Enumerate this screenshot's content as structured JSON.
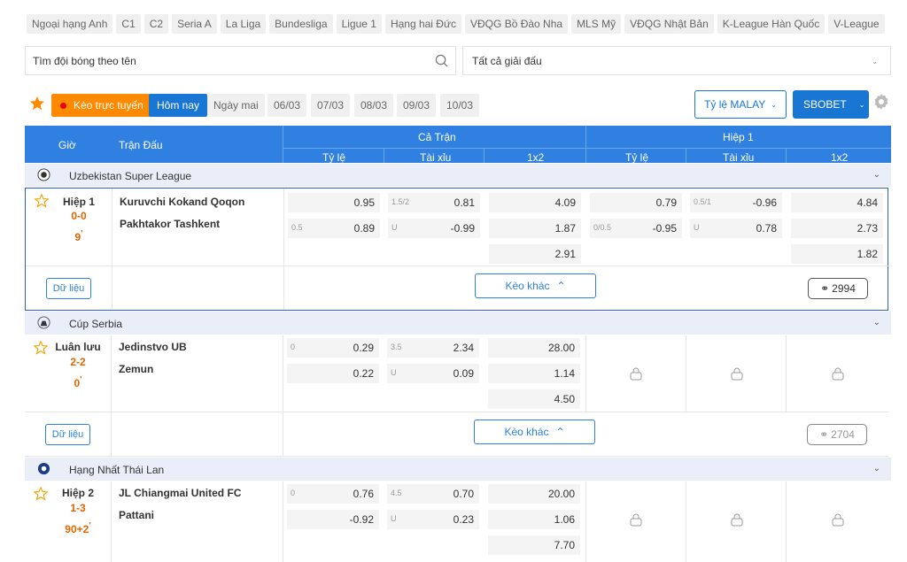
{
  "leagues": [
    "Ngoại hạng Anh",
    "C1",
    "C2",
    "Seria A",
    "La Liga",
    "Bundesliga",
    "Ligue 1",
    "Hạng hai Đức",
    "VĐQG Bồ Đào Nha",
    "MLS Mỹ",
    "VĐQG Nhật Bản",
    "K-League Hàn Quốc",
    "V-League"
  ],
  "search": {
    "placeholder": "Tìm đội bóng theo tên"
  },
  "tournament_select": {
    "value": "Tất cả giải đấu"
  },
  "filters": {
    "live": "Kèo trực tuyến",
    "today": "Hôm nay",
    "tomorrow": "Ngày mai",
    "dates": [
      "06/03",
      "07/03",
      "08/03",
      "09/03",
      "10/03"
    ],
    "rate": "Tỷ lệ MALAY",
    "bookmaker": "SBOBET"
  },
  "table_header": {
    "time": "Giờ",
    "match": "Trận Đấu",
    "full": "Cả Trận",
    "half": "Hiệp 1",
    "hdp": "Tỷ lệ",
    "ou": "Tài xỉu",
    "x12": "1x2"
  },
  "buttons": {
    "data": "Dữ liệu",
    "more": "Kèo khác"
  },
  "groups": [
    {
      "league": "Uzbekistan Super League",
      "status": "Hiệp 1",
      "score": "0-0",
      "minute": "9",
      "home": "Kuruvchi Kokand Qoqon",
      "away": "Pakhtakor Tashkent",
      "viewers": "2994",
      "full": {
        "hdp": [
          [
            "",
            "0.95"
          ],
          [
            "0.5",
            "0.89"
          ]
        ],
        "ou": [
          [
            "1.5/2",
            "0.81"
          ],
          [
            "U",
            "-0.99"
          ]
        ],
        "x12": [
          "4.09",
          "1.87",
          "2.91"
        ]
      },
      "half": {
        "hdp": [
          [
            "",
            "0.79"
          ],
          [
            "0/0.5",
            "-0.95"
          ]
        ],
        "ou": [
          [
            "0.5/1",
            "-0.96"
          ],
          [
            "U",
            "0.78"
          ]
        ],
        "x12": [
          "4.84",
          "2.73",
          "1.82"
        ]
      }
    },
    {
      "league": "Cúp Serbia",
      "status": "Luân lưu",
      "score": "2-2",
      "minute": "0",
      "home": "Jedinstvo UB",
      "away": "Zemun",
      "viewers": "2704",
      "full": {
        "hdp": [
          [
            "0",
            "0.29"
          ],
          [
            "",
            "0.22"
          ]
        ],
        "ou": [
          [
            "3.5",
            "2.34"
          ],
          [
            "U",
            "0.09"
          ]
        ],
        "x12": [
          "28.00",
          "1.14",
          "4.50"
        ]
      }
    },
    {
      "league": "Hạng Nhất Thái Lan",
      "status": "Hiệp 2",
      "score": "1-3",
      "minute": "90+2",
      "home": "JL Chiangmai United FC",
      "away": "Pattani",
      "full": {
        "hdp": [
          [
            "0",
            "0.76"
          ],
          [
            "",
            "-0.92"
          ]
        ],
        "ou": [
          [
            "4.5",
            "0.70"
          ],
          [
            "U",
            "0.23"
          ]
        ],
        "x12": [
          "20.00",
          "1.06",
          "7.70"
        ]
      }
    }
  ],
  "colors": {
    "accent": "#2f80e0",
    "live": "#ff8a00",
    "score": "#e56400"
  }
}
